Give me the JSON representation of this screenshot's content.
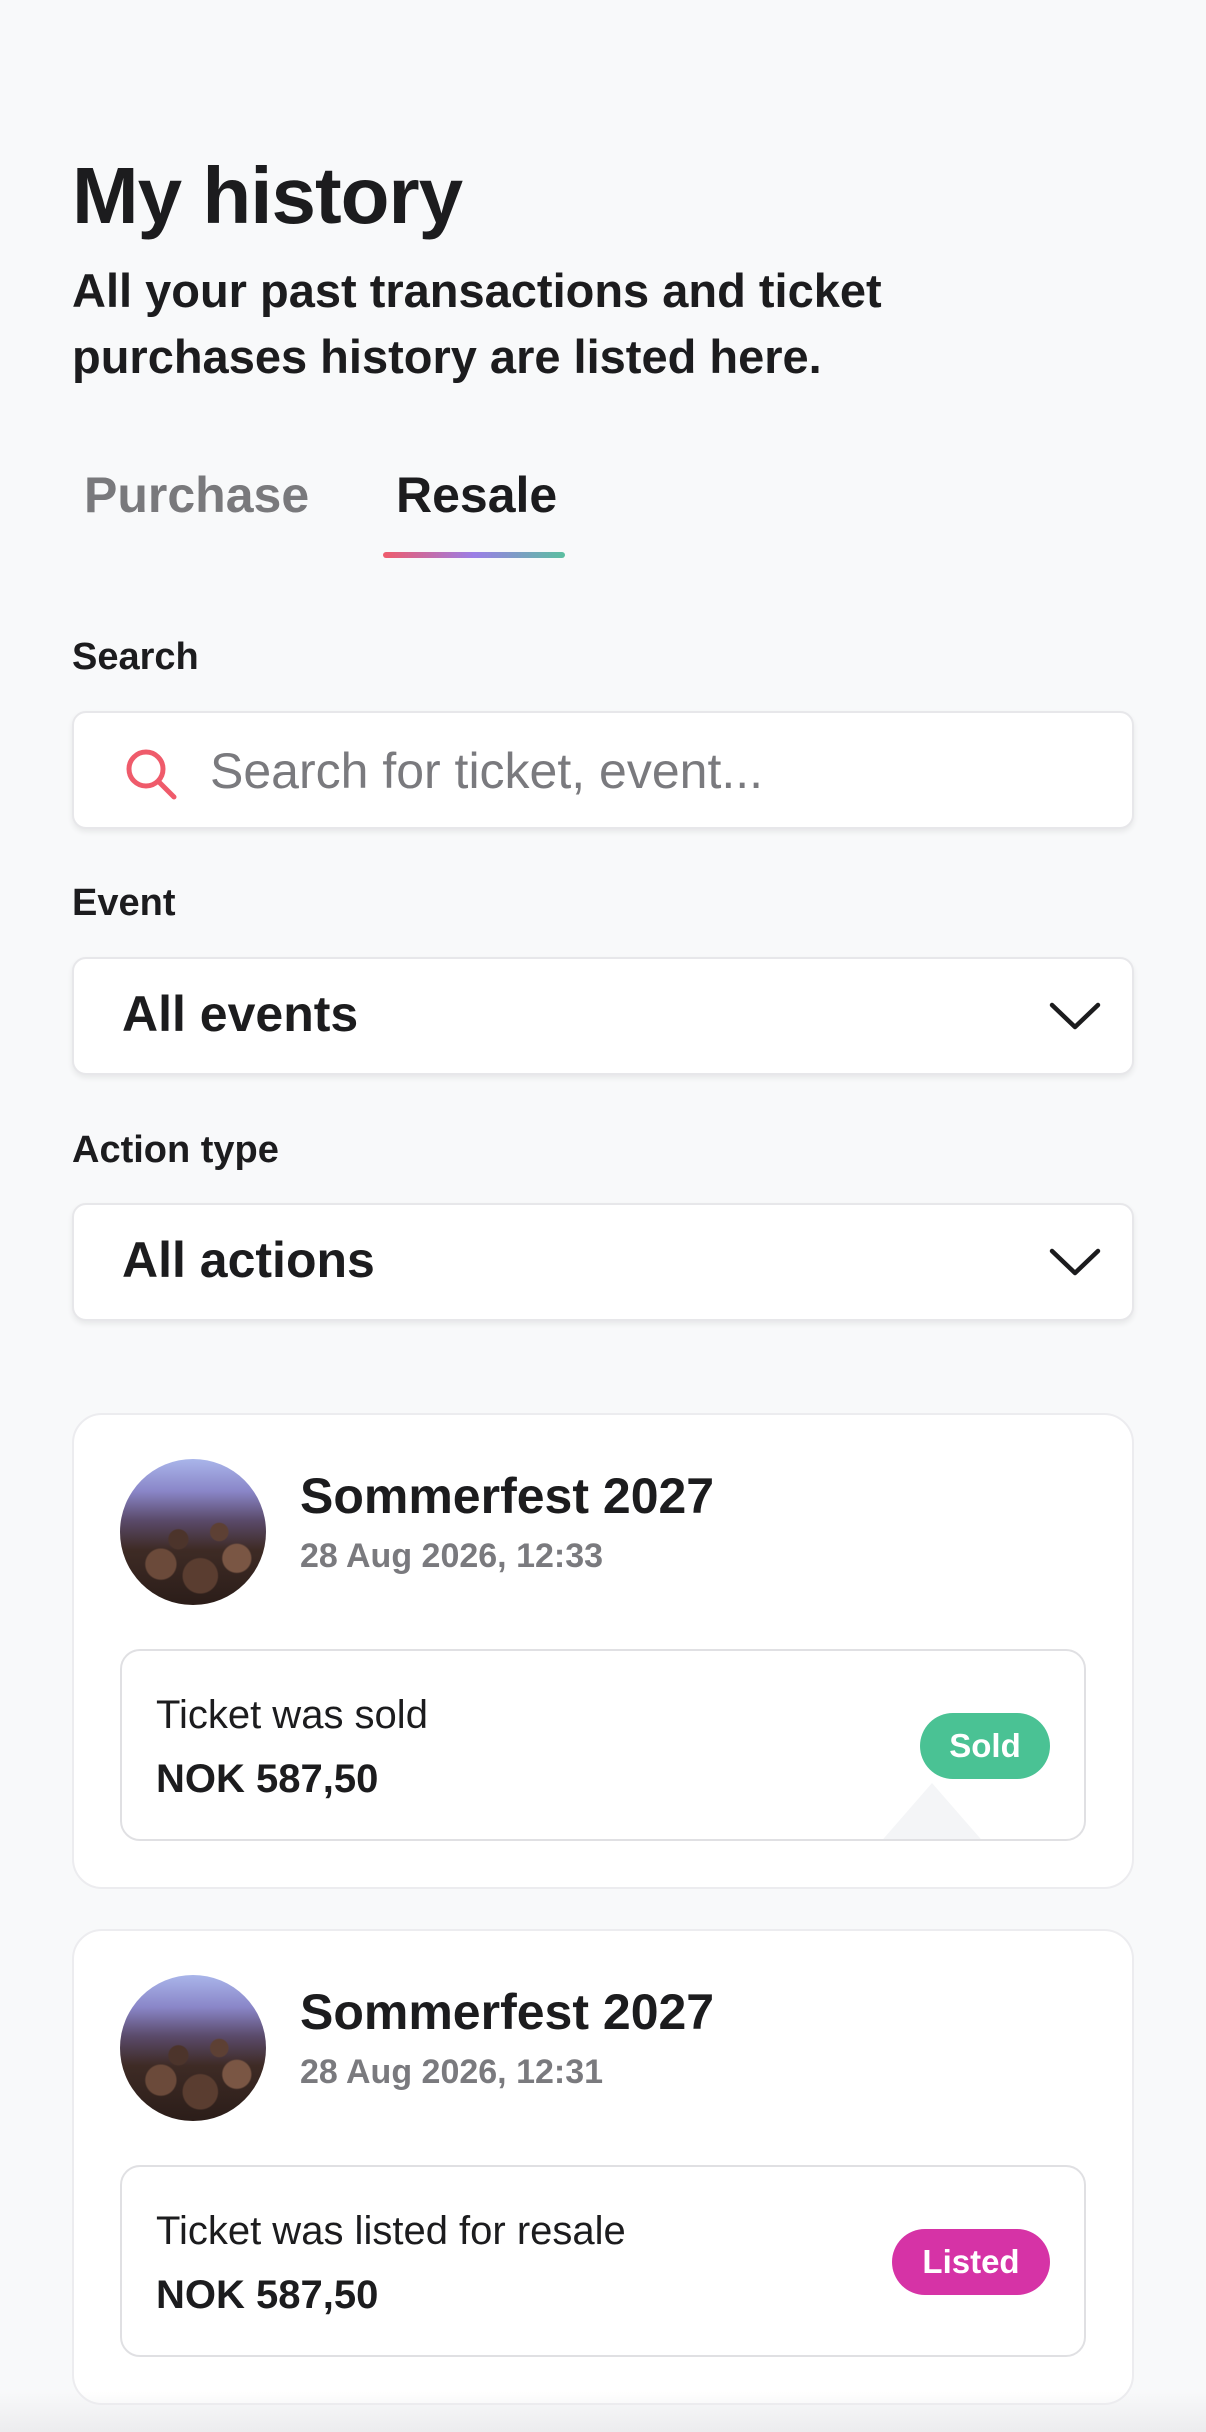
{
  "header": {
    "title": "My history",
    "subtitle": "All your past transactions and ticket purchases history are listed here."
  },
  "tabs": [
    {
      "label": "Purchase",
      "active": false
    },
    {
      "label": "Resale",
      "active": true
    }
  ],
  "filters": {
    "search": {
      "label": "Search",
      "placeholder": "Search for ticket, event...",
      "value": ""
    },
    "event": {
      "label": "Event",
      "selected": "All events"
    },
    "action_type": {
      "label": "Action type",
      "selected": "All actions"
    }
  },
  "history": [
    {
      "event": "Sommerfest 2027",
      "datetime": "28 Aug 2026, 12:33",
      "action": "Ticket was sold",
      "price": "NOK 587,50",
      "status": "Sold",
      "status_color": "#4ac294"
    },
    {
      "event": "Sommerfest 2027",
      "datetime": "28 Aug 2026, 12:31",
      "action": "Ticket was listed for resale",
      "price": "NOK 587,50",
      "status": "Listed",
      "status_color": "#d633a6"
    }
  ],
  "colors": {
    "background": "#f8f9fa",
    "tab_underline_gradient": [
      "#ef5b6b",
      "#9b7ee6",
      "#5bbfa0"
    ],
    "search_icon": "#ef5b6b"
  },
  "icons": {
    "search": "search-icon",
    "dropdown": "chevron-down-icon"
  }
}
